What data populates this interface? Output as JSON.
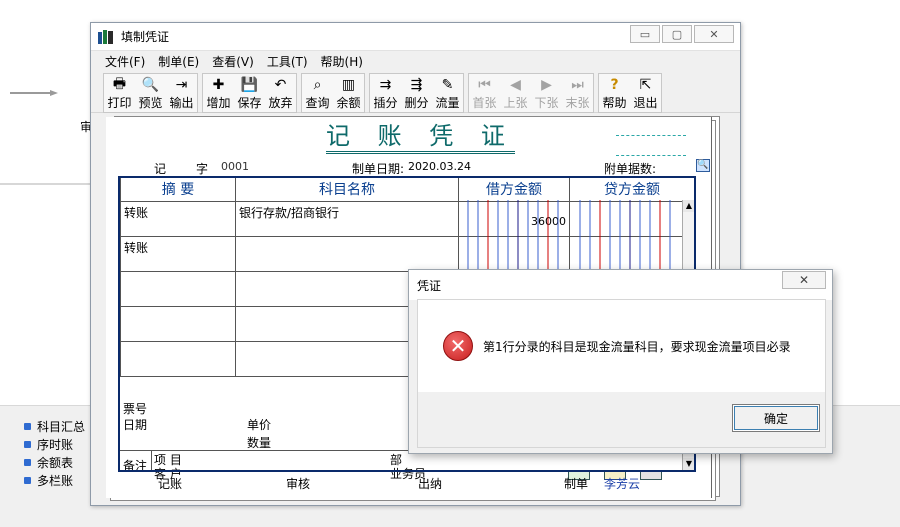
{
  "background": {
    "cut_label": "审",
    "left_list": [
      "科目汇总",
      "序时账",
      "余额表",
      "多栏账"
    ]
  },
  "window": {
    "title": "填制凭证",
    "controls": {
      "minimize": "▭",
      "restore": "▢",
      "close": "✕"
    }
  },
  "menu": [
    "文件(F)",
    "制单(E)",
    "查看(V)",
    "工具(T)",
    "帮助(H)"
  ],
  "toolbar": {
    "groups": [
      [
        {
          "label": "打印",
          "icon": "printer-icon",
          "glyph": "🖶"
        },
        {
          "label": "预览",
          "icon": "preview-icon",
          "glyph": "🔍"
        },
        {
          "label": "输出",
          "icon": "export-icon",
          "glyph": "⇥"
        }
      ],
      [
        {
          "label": "增加",
          "icon": "add-icon",
          "glyph": "✚"
        },
        {
          "label": "保存",
          "icon": "save-icon",
          "glyph": "💾"
        },
        {
          "label": "放弃",
          "icon": "undo-icon",
          "glyph": "↶"
        }
      ],
      [
        {
          "label": "查询",
          "icon": "binoculars-icon",
          "glyph": "⌕"
        },
        {
          "label": "余额",
          "icon": "balance-chart-icon",
          "glyph": "▥"
        }
      ],
      [
        {
          "label": "插分",
          "icon": "insert-row-icon",
          "glyph": "⇉"
        },
        {
          "label": "删分",
          "icon": "delete-row-icon",
          "glyph": "⇶"
        },
        {
          "label": "流量",
          "icon": "cashflow-icon",
          "glyph": "✎"
        }
      ],
      [
        {
          "label": "首张",
          "icon": "first-icon",
          "glyph": "⏮",
          "disabled": true
        },
        {
          "label": "上张",
          "icon": "prev-icon",
          "glyph": "◀",
          "disabled": true
        },
        {
          "label": "下张",
          "icon": "next-icon",
          "glyph": "▶",
          "disabled": true
        },
        {
          "label": "末张",
          "icon": "last-icon",
          "glyph": "⏭",
          "disabled": true
        }
      ],
      [
        {
          "label": "帮助",
          "icon": "help-icon",
          "glyph": "?"
        },
        {
          "label": "退出",
          "icon": "exit-icon",
          "glyph": "⇱"
        }
      ]
    ]
  },
  "voucher": {
    "title": "记 账 凭 证",
    "type_label": "记",
    "number_label": "字",
    "number": "0001",
    "date_label": "制单日期:",
    "date": "2020.03.24",
    "attachments_label": "附单据数:",
    "headers": {
      "summary": "摘 要",
      "account": "科目名称",
      "debit": "借方金额",
      "credit": "贷方金额"
    },
    "rows": [
      {
        "summary": "转账",
        "account": "银行存款/招商银行",
        "debit": "36000",
        "credit": ""
      },
      {
        "summary": "转账",
        "account": "",
        "debit": "",
        "credit": ""
      },
      {
        "summary": "",
        "account": "",
        "debit": "",
        "credit": ""
      },
      {
        "summary": "",
        "account": "",
        "debit": "",
        "credit": ""
      },
      {
        "summary": "",
        "account": "",
        "debit": "",
        "credit": ""
      }
    ],
    "lower": {
      "ticket_no": "票号",
      "date": "日期",
      "unit_price": "单价",
      "quantity": "数量",
      "remark": "备注",
      "project": "项  目",
      "customer": "客  户",
      "department": "部",
      "salesperson": "业务员"
    },
    "footer": {
      "bookkeeping": "记账",
      "audit": "审核",
      "cashier": "出纳",
      "maker_label": "制单",
      "maker": "李芳云"
    }
  },
  "dialog": {
    "title": "凭证",
    "close": "✕",
    "message": "第1行分录的科目是现金流量科目，要求现金流量项目必录",
    "ok": "确定"
  }
}
